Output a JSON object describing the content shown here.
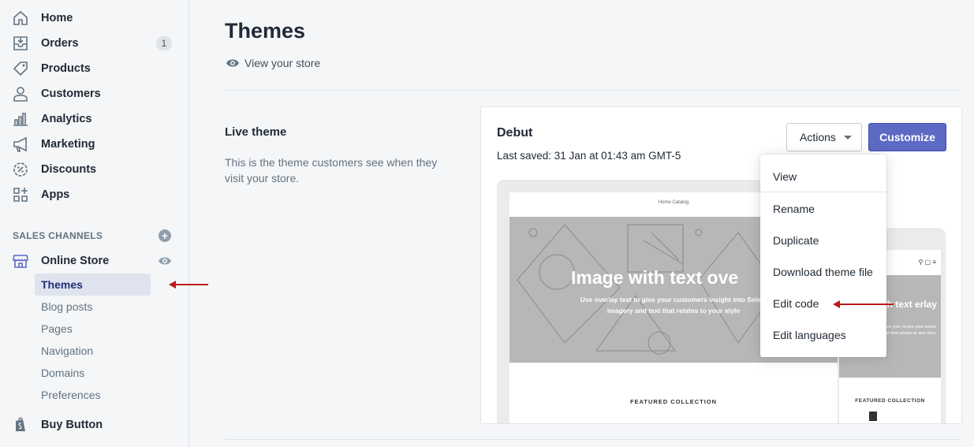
{
  "sidebar": {
    "nav": [
      {
        "label": "Home",
        "icon": "home-icon"
      },
      {
        "label": "Orders",
        "icon": "orders-icon",
        "badge": "1"
      },
      {
        "label": "Products",
        "icon": "tag-icon"
      },
      {
        "label": "Customers",
        "icon": "person-icon"
      },
      {
        "label": "Analytics",
        "icon": "bar-chart-icon"
      },
      {
        "label": "Marketing",
        "icon": "megaphone-icon"
      },
      {
        "label": "Discounts",
        "icon": "discount-icon"
      },
      {
        "label": "Apps",
        "icon": "apps-icon"
      }
    ],
    "sales_channels_title": "SALES CHANNELS",
    "online_store": "Online Store",
    "sub_items": [
      "Themes",
      "Blog posts",
      "Pages",
      "Navigation",
      "Domains",
      "Preferences"
    ],
    "buy_button": "Buy Button"
  },
  "main": {
    "title": "Themes",
    "view_store": "View your store",
    "live_theme": {
      "title": "Live theme",
      "description": "This is the theme customers see when they visit your store."
    },
    "theme_card": {
      "name": "Debut",
      "last_saved": "Last saved: 31 Jan at 01:43 am GMT-5",
      "actions_label": "Actions",
      "customize_label": "Customize"
    },
    "preview": {
      "nav_text": "Home    Catalog",
      "hero_title": "Image with text ove",
      "hero_sub": "Use overlay text to give your customers insight into Select imagery and text that relates to your style",
      "featured": "FEATURED COLLECTION",
      "mobile_hero_title": "with text erlay",
      "mobile_hero_sub": "ext to give your nt into your brand. nd text that relates le and story.",
      "mobile_featured": "FEATURED COLLECTION"
    },
    "actions_menu": [
      "View",
      "Rename",
      "Duplicate",
      "Download theme file",
      "Edit code",
      "Edit languages"
    ]
  },
  "colors": {
    "accent": "#5c6ac4",
    "annotation_arrow": "#c0171b"
  }
}
